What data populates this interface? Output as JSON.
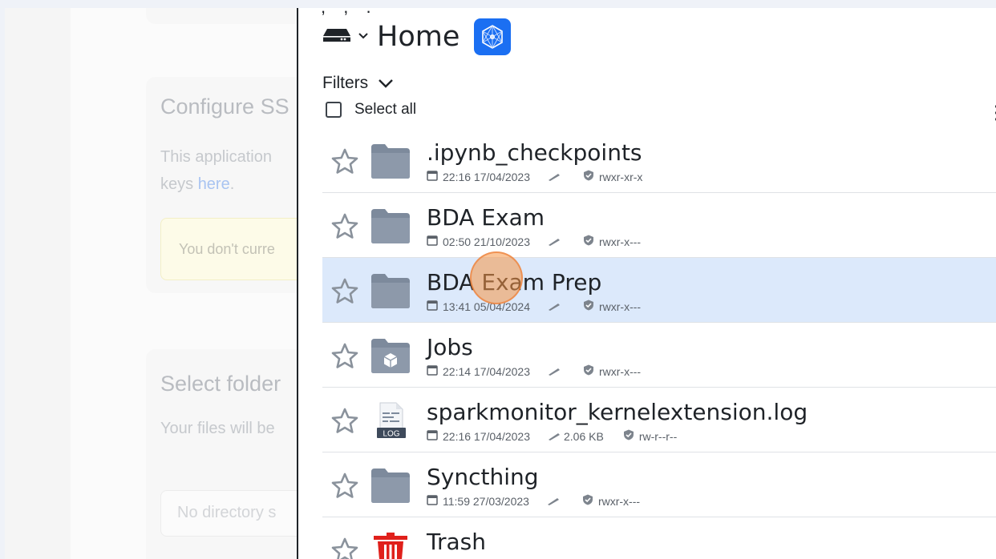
{
  "background": {
    "card1_title": "Configure SS",
    "card1_text_line1": "This application",
    "card1_text_line2_prefix": "keys ",
    "card1_link": "here",
    "card1_text_line2_suffix": ".",
    "card1_warning": "You don't curre",
    "card2_title": "Select folder",
    "card2_text": "Your files will be",
    "card2_input_placeholder": "No directory s"
  },
  "header": {
    "cut_text": ", ,       .",
    "title": "Home",
    "drive_icon": "drive-icon",
    "app_icon": "cube-network-icon"
  },
  "toolbar": {
    "filters_label": "Filters",
    "select_all_label": "Select all"
  },
  "files": [
    {
      "name": ".ipynb_checkpoints",
      "time": "22:16 17/04/2023",
      "size": "",
      "perms": "rwxr-xr-x",
      "icon": "folder-icon",
      "selected": false
    },
    {
      "name": "BDA Exam",
      "time": "02:50 21/10/2023",
      "size": "",
      "perms": "rwxr-x---",
      "icon": "folder-icon",
      "selected": false
    },
    {
      "name": "BDA Exam Prep",
      "time": "13:41 05/04/2024",
      "size": "",
      "perms": "rwxr-x---",
      "icon": "folder-icon",
      "selected": true
    },
    {
      "name": "Jobs",
      "time": "22:14 17/04/2023",
      "size": "",
      "perms": "rwxr-x---",
      "icon": "jobs-folder-icon",
      "selected": false
    },
    {
      "name": "sparkmonitor_kernelextension.log",
      "time": "22:16 17/04/2023",
      "size": "2.06 KB",
      "perms": "rw-r--r--",
      "icon": "log-file-icon",
      "selected": false
    },
    {
      "name": "Syncthing",
      "time": "11:59 27/03/2023",
      "size": "",
      "perms": "rwxr-x---",
      "icon": "folder-icon",
      "selected": false
    },
    {
      "name": "Trash",
      "time": "",
      "size": "",
      "perms": "",
      "icon": "trash-icon",
      "selected": false
    }
  ],
  "colors": {
    "accent": "#1b6ff2",
    "selected_row": "#dce9fb",
    "folder": "#7d8a9c",
    "trash": "#e0201b"
  }
}
